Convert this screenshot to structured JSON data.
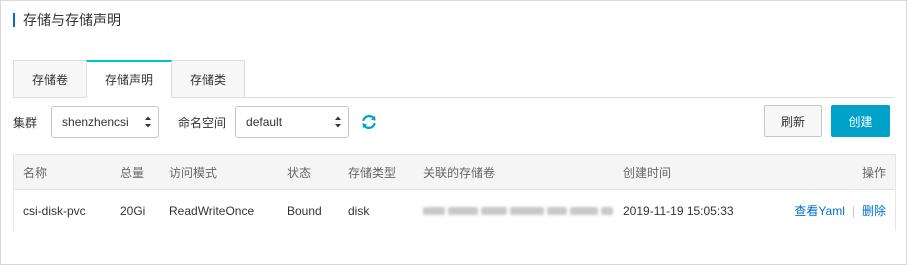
{
  "page": {
    "title": "存储与存储声明"
  },
  "tabs": [
    {
      "label": "存储卷",
      "active": false
    },
    {
      "label": "存储声明",
      "active": true
    },
    {
      "label": "存储类",
      "active": false
    }
  ],
  "filters": {
    "cluster_label": "集群",
    "cluster_value": "shenzhencsi",
    "namespace_label": "命名空间",
    "namespace_value": "default"
  },
  "actions": {
    "refresh_label": "刷新",
    "create_label": "创建"
  },
  "colors": {
    "accent": "#00a2ca",
    "link": "#0070cc",
    "tab_active": "#00c1de"
  },
  "table": {
    "columns": [
      "名称",
      "总量",
      "访问模式",
      "状态",
      "存储类型",
      "关联的存储卷",
      "创建时间",
      "操作"
    ],
    "rows": [
      {
        "name": "csi-disk-pvc",
        "capacity": "20Gi",
        "access_mode": "ReadWriteOnce",
        "status": "Bound",
        "storage_type": "disk",
        "volume": "",
        "created": "2019-11-19 15:05:33",
        "ops": {
          "view": "查看Yaml",
          "delete": "删除"
        }
      }
    ]
  }
}
